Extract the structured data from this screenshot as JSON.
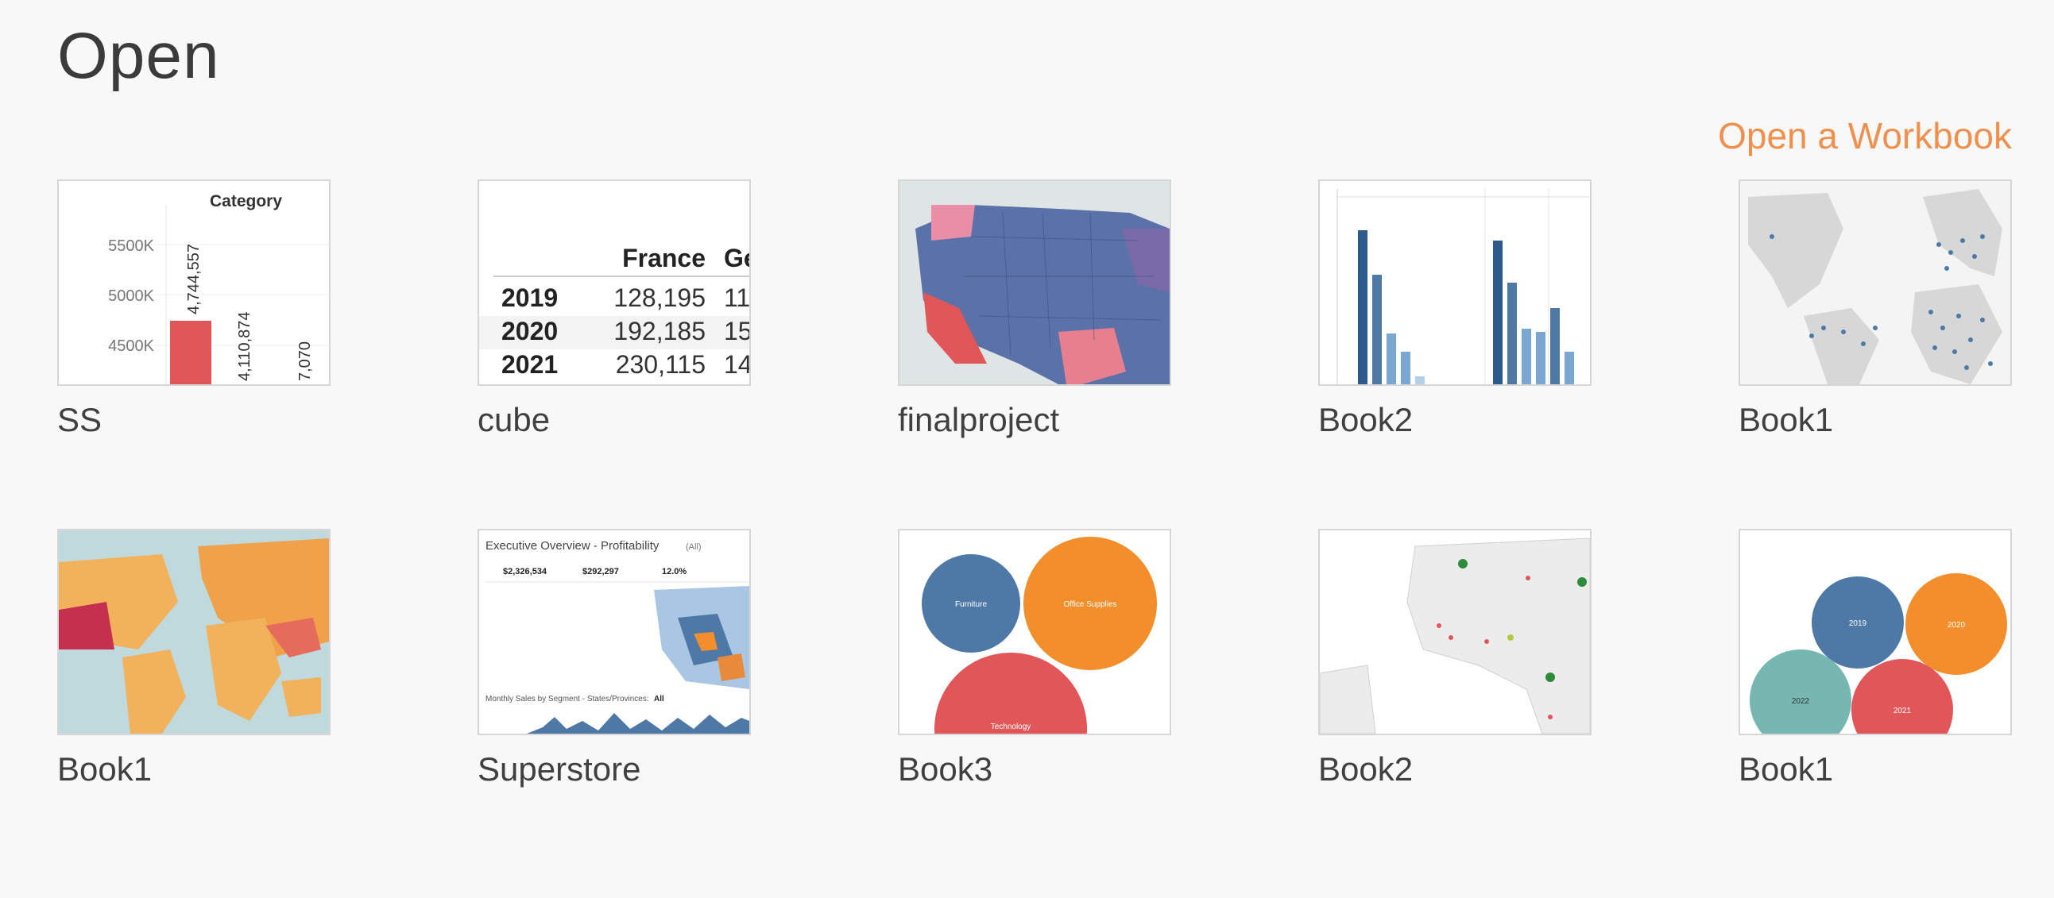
{
  "page": {
    "title": "Open",
    "open_workbook_link": "Open a Workbook"
  },
  "workbooks": [
    {
      "name": "SS",
      "preview": {
        "header": "Category",
        "y_ticks": [
          "5500K",
          "5000K",
          "4500K"
        ],
        "bar_labels": [
          "4,744,557",
          "4,110,874",
          "7,070"
        ]
      }
    },
    {
      "name": "cube",
      "preview": {
        "columns": [
          "France",
          "Ge"
        ],
        "rows": [
          {
            "year": "2019",
            "france": "128,195",
            "ge": "11"
          },
          {
            "year": "2020",
            "france": "192,185",
            "ge": "15"
          },
          {
            "year": "2021",
            "france": "230,115",
            "ge": "14"
          }
        ]
      }
    },
    {
      "name": "finalproject"
    },
    {
      "name": "Book2"
    },
    {
      "name": "Book1"
    },
    {
      "name": "Book1"
    },
    {
      "name": "Superstore",
      "preview": {
        "title": "Executive Overview - Profitability",
        "title_suffix": "(All)",
        "kpi_values": [
          "$2,326,534",
          "$292,297",
          "12.0%"
        ],
        "footer": "Monthly Sales by Segment - States/Provinces:",
        "footer_value": "All"
      }
    },
    {
      "name": "Book3",
      "preview": {
        "bubbles": [
          "Furniture",
          "Office Supplies",
          "Technology"
        ]
      }
    },
    {
      "name": "Book2"
    },
    {
      "name": "Book1",
      "preview": {
        "bubbles": [
          "2019",
          "2020",
          "2022",
          "2021"
        ]
      }
    }
  ],
  "colors": {
    "accent": "#f0904e",
    "tableau_blue": "#4e79a7",
    "tableau_orange": "#f28e2b",
    "tableau_red": "#e15759",
    "tableau_teal": "#76b7b2"
  }
}
